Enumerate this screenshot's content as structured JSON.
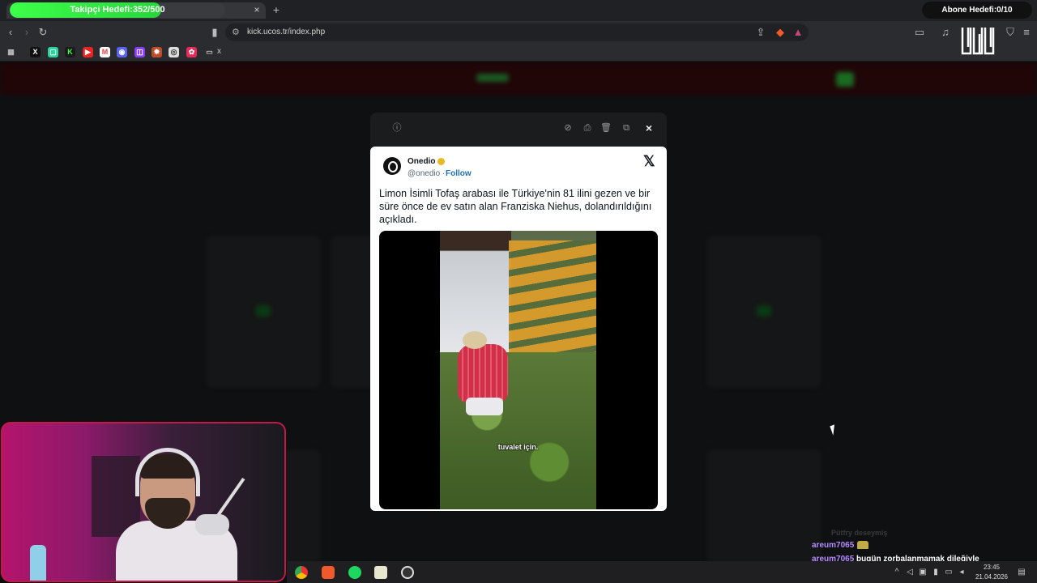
{
  "overlay": {
    "follower_goal_label": "Takipçi Hedefi:352/500",
    "follower_goal_progress": 0.704,
    "subscriber_goal_label": "Abone Hedefi:0/10"
  },
  "browser": {
    "url": "kick.ucos.tr/index.php",
    "tab_close": "×",
    "tab_new": "+",
    "bookmarks_folder_label": "x"
  },
  "modal": {
    "close_label": "×"
  },
  "tweet": {
    "author_name": "Onedio",
    "author_handle": "@onedio",
    "separator": " · ",
    "follow_label": "Follow",
    "x_logo": "𝕏",
    "text": "Limon İsimli Tofaş arabası ile Türkiye'nin 81 ilini gezen ve bir süre önce de ev satın alan Franziska Niehus, dolandırıldığını açıkladı.",
    "video_caption": "tuvalet için."
  },
  "chat": {
    "faded_line": "Pütfry  deseymiş",
    "messages": [
      {
        "user": "areum7065",
        "message": "",
        "emote": true
      },
      {
        "user": "areum7065",
        "message": "bugün zorbalanmamak dileğiyle",
        "emote": false
      },
      {
        "user": "areum7065",
        "message": "",
        "emote": true
      }
    ]
  },
  "taskbar": {
    "time": "23:45",
    "date": "21.04.2026"
  },
  "colors": {
    "accent_green": "#3dff4a",
    "webcam_border": "#c4184a",
    "chat_username": "#b48cff",
    "follow_link": "#1d6fb8"
  }
}
